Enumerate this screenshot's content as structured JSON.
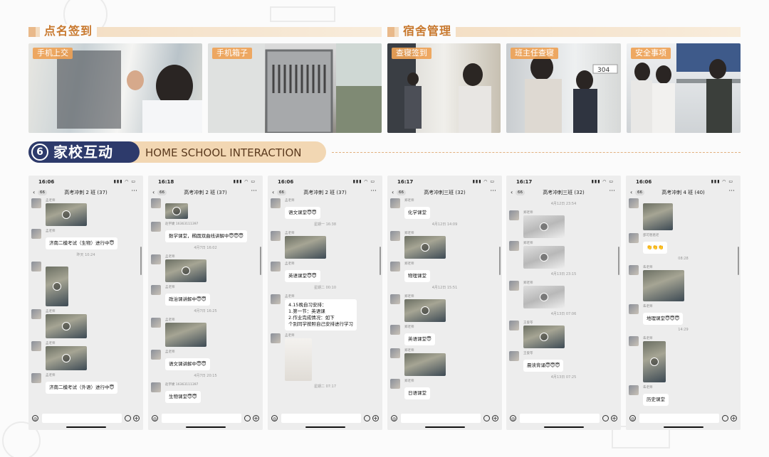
{
  "sections": {
    "rollcall": {
      "title": "点名签到"
    },
    "dorm": {
      "title": "宿舍管理"
    }
  },
  "photos": [
    {
      "tag": "手机上交"
    },
    {
      "tag": "手机箱子"
    },
    {
      "tag": "查寝签到"
    },
    {
      "tag": "班主任查寝"
    },
    {
      "tag": "安全事项"
    }
  ],
  "home_school": {
    "number": "6",
    "title_cn": "家校互动",
    "title_en": "HOME SCHOOL INTERACTION"
  },
  "phones": [
    {
      "time": "16:06",
      "badge": "66",
      "title": "高考冲刺 2 班 (37)",
      "msgs": [
        {
          "type": "vid",
          "name": "孟老师",
          "w": 58,
          "h": 32
        },
        {
          "type": "text",
          "name": "孟老师",
          "text": "济南二模考试（生物）进行中😇"
        },
        {
          "type": "time",
          "text": "昨天 10:24"
        },
        {
          "type": "vid",
          "name": "",
          "w": 32,
          "h": 56
        },
        {
          "type": "vid",
          "name": "孟老师",
          "w": 58,
          "h": 34
        },
        {
          "type": "vid",
          "name": "孟老师",
          "w": 58,
          "h": 34
        },
        {
          "type": "text",
          "name": "孟老师",
          "text": "济南二模考试（外语）进行中😇"
        }
      ]
    },
    {
      "time": "16:18",
      "badge": "66",
      "title": "高考冲刺 2 班 (37)",
      "msgs": [
        {
          "type": "vid",
          "name": "",
          "w": 32,
          "h": 22
        },
        {
          "type": "text",
          "name": "赵宇婕 16363111397",
          "text": "数学课堂，椭圆双曲线讲解中😇😇😇"
        },
        {
          "type": "time",
          "text": "4月7日 16:02"
        },
        {
          "type": "vid",
          "name": "孟老师",
          "w": 58,
          "h": 32
        },
        {
          "type": "text",
          "name": "孟老师",
          "text": "政治课讲解中😇😇"
        },
        {
          "type": "time",
          "text": "4月7日 16:25"
        },
        {
          "type": "img",
          "name": "孟老师",
          "w": 58,
          "h": 34
        },
        {
          "type": "text",
          "name": "孟老师",
          "text": "语文课讲解中😇😇"
        },
        {
          "type": "time",
          "text": "4月7日 20:15"
        },
        {
          "type": "text",
          "name": "赵宇婕 16363111397",
          "text": "生物课堂😇😇"
        }
      ]
    },
    {
      "time": "16:06",
      "badge": "66",
      "title": "高考冲刺 2 班 (37)",
      "msgs": [
        {
          "type": "text",
          "name": "孟老师",
          "text": "语文课堂😇😇"
        },
        {
          "type": "time",
          "text": "星期一 16:38"
        },
        {
          "type": "img",
          "name": "孟老师",
          "w": 58,
          "h": 32
        },
        {
          "type": "text",
          "name": "孟老师",
          "text": "英语课堂😇😇"
        },
        {
          "type": "time",
          "text": "星期二 00:10"
        },
        {
          "type": "text",
          "name": "孟老师",
          "text": "4.15晚自习安排：\n1.第一节：英语课\n2.作业完成情况：如下\n个别同学按照自己安排进行学习"
        },
        {
          "type": "paper",
          "name": "孟老师",
          "w": 38,
          "h": 60
        },
        {
          "type": "time",
          "text": "星期二 07:17"
        }
      ]
    },
    {
      "time": "16:17",
      "badge": "66",
      "title": "高考冲刺三班 (32)",
      "msgs": [
        {
          "type": "text",
          "name": "郑老师",
          "text": "化学课堂"
        },
        {
          "type": "time",
          "text": "4月12日 14:09"
        },
        {
          "type": "vid",
          "name": "郑老师",
          "w": 58,
          "h": 32
        },
        {
          "type": "text",
          "name": "郑老师",
          "text": "物理课堂"
        },
        {
          "type": "time",
          "text": "4月12日 15:51"
        },
        {
          "type": "vid",
          "name": "郑老师",
          "w": 58,
          "h": 32
        },
        {
          "type": "text",
          "name": "郑老师",
          "text": "英语课堂😇"
        },
        {
          "type": "img",
          "name": "郑老师",
          "w": 58,
          "h": 32
        },
        {
          "type": "text",
          "name": "郑老师",
          "text": "日语课堂"
        }
      ]
    },
    {
      "time": "16:17",
      "badge": "66",
      "title": "高考冲刺三班 (32)",
      "msgs": [
        {
          "type": "time",
          "text": "4月12日 23:54"
        },
        {
          "type": "lightvid",
          "name": "郑老师",
          "w": 58,
          "h": 32
        },
        {
          "type": "lightvid",
          "name": "郑老师",
          "w": 58,
          "h": 32
        },
        {
          "type": "time",
          "text": "4月13日 23:15"
        },
        {
          "type": "lightvid",
          "name": "郑老师",
          "w": 58,
          "h": 32
        },
        {
          "type": "time",
          "text": "4月13日 07:06"
        },
        {
          "type": "vid",
          "name": "王俊苓",
          "w": 58,
          "h": 32
        },
        {
          "type": "text",
          "name": "王俊苓",
          "text": "晨读背诵😇😇😇"
        },
        {
          "type": "time",
          "text": "4月13日 07:25"
        }
      ]
    },
    {
      "time": "16:06",
      "badge": "66",
      "title": "高考冲刺 4 班 (40)",
      "msgs": [
        {
          "type": "img",
          "name": "",
          "w": 42,
          "h": 38
        },
        {
          "type": "text",
          "name": "邵可爸爸老",
          "text": "👏👏👏"
        },
        {
          "type": "time",
          "text": "08:28"
        },
        {
          "type": "img",
          "name": "朱老师",
          "w": 58,
          "h": 44
        },
        {
          "type": "text",
          "name": "朱老师",
          "text": "地理课堂😇😇😇"
        },
        {
          "type": "time",
          "text": "14:29"
        },
        {
          "type": "vid",
          "name": "朱老师",
          "w": 32,
          "h": 58
        },
        {
          "type": "text",
          "name": "朱老师",
          "text": "历史课堂"
        }
      ]
    }
  ],
  "colors": {
    "accent": "#c8782d",
    "navy": "#2d3a6b",
    "pill": "#f2d7b3"
  }
}
